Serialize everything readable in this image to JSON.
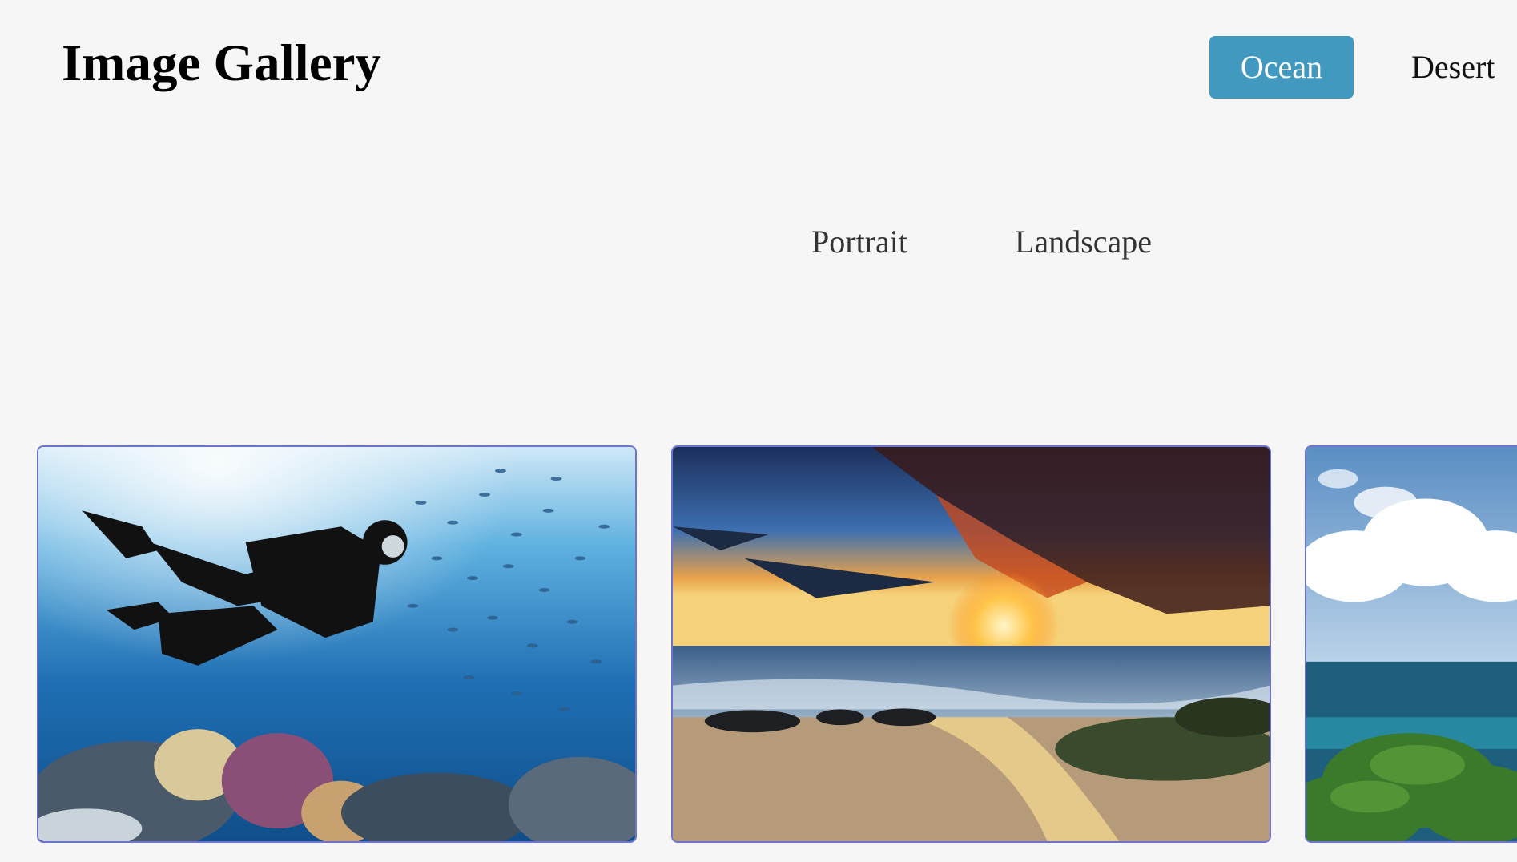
{
  "header": {
    "title": "Image Gallery"
  },
  "nav": {
    "items": [
      {
        "label": "Ocean",
        "active": true
      },
      {
        "label": "Desert",
        "active": false
      }
    ]
  },
  "orientation": {
    "options": [
      {
        "label": "Portrait"
      },
      {
        "label": "Landscape"
      }
    ]
  },
  "gallery": {
    "images": [
      {
        "subject": "scuba-diver-coral-reef"
      },
      {
        "subject": "sunset-beach-waves"
      },
      {
        "subject": "sea-clouds-trees"
      }
    ],
    "accent_color": "#4299c0",
    "border_color": "#6d74cf"
  }
}
